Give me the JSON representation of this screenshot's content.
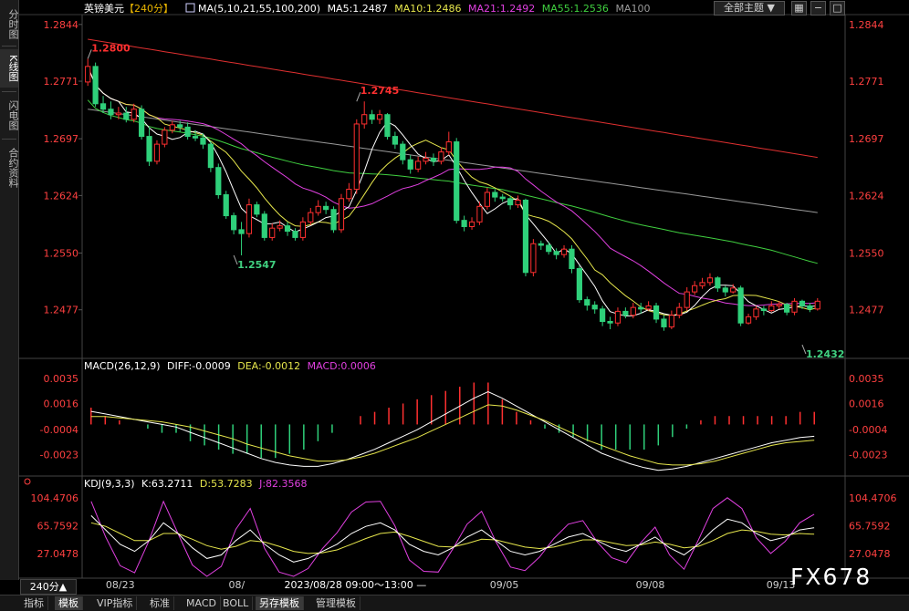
{
  "sidebar": {
    "tabs": [
      {
        "label": "分时图",
        "active": false
      },
      {
        "label": "K线图",
        "active": true
      },
      {
        "label": "闪电图",
        "active": false
      },
      {
        "label": "合约资料",
        "active": false
      }
    ]
  },
  "header": {
    "symbol": "英镑美元",
    "period": "【240分】",
    "ma_label": "MA(5,10,21,55,100,200)",
    "ma5": "MA5:1.2487",
    "ma10": "MA10:1.2486",
    "ma21": "MA21:1.2492",
    "ma55": "MA55:1.2536",
    "ma100": "MA100",
    "theme_button": "全部主题",
    "colors": {
      "symbol": "#ffffff",
      "period": "#e8b400",
      "ma5": "#ffffff",
      "ma10": "#e6e64c",
      "ma21": "#e040e0",
      "ma55": "#40d040",
      "ma100": "#9a9a9a",
      "ma200": "#e03030"
    }
  },
  "macd_header": {
    "label": "MACD(26,12,9)",
    "diff": "DIFF:-0.0009",
    "dea": "DEA:-0.0012",
    "macd": "MACD:0.0006"
  },
  "kdj_header": {
    "label": "KDJ(9,3,3)",
    "k": "K:63.2711",
    "d": "D:53.7283",
    "j": "J:82.3568"
  },
  "chart_data": {
    "type": "candlestick",
    "price_axis_ticks": [
      "1.2844",
      "1.2771",
      "1.2697",
      "1.2624",
      "1.2550",
      "1.2477"
    ],
    "price_range": [
      1.2418,
      1.2852
    ],
    "annotations": [
      {
        "text": "1.2800",
        "value": 1.28,
        "index": 0,
        "color": "#ff3030"
      },
      {
        "text": "1.2745",
        "value": 1.2745,
        "index": 35,
        "color": "#ff3030"
      },
      {
        "text": "1.2547",
        "value": 1.2547,
        "index": 19,
        "color": "#40d080"
      },
      {
        "text": "1.2432",
        "value": 1.2432,
        "index": 93,
        "color": "#40d080"
      }
    ],
    "x_labels": [
      {
        "text": "08/23",
        "index": 4
      },
      {
        "text": "08/",
        "index": 20
      },
      {
        "text": "09/05",
        "index": 54
      },
      {
        "text": "09/08",
        "index": 73
      },
      {
        "text": "09/13",
        "index": 90
      }
    ],
    "crosshair_label": "2023/08/28 09:00～13:00 —",
    "crosshair_index": 27,
    "close": [
      1.279,
      1.2742,
      1.2735,
      1.2728,
      1.273,
      1.2722,
      1.2735,
      1.27,
      1.2668,
      1.269,
      1.2708,
      1.2715,
      1.2712,
      1.27,
      1.2698,
      1.269,
      1.266,
      1.2625,
      1.2598,
      1.258,
      1.2575,
      1.2612,
      1.26,
      1.257,
      1.2582,
      1.2585,
      1.2578,
      1.257,
      1.259,
      1.2602,
      1.261,
      1.2606,
      1.258,
      1.262,
      1.2632,
      1.2716,
      1.2728,
      1.2722,
      1.2728,
      1.27,
      1.269,
      1.267,
      1.2658,
      1.2668,
      1.2672,
      1.2668,
      1.268,
      1.2693,
      1.2592,
      1.2584,
      1.259,
      1.261,
      1.2628,
      1.2622,
      1.262,
      1.2612,
      1.2618,
      1.2525,
      1.2562,
      1.256,
      1.2552,
      1.2548,
      1.2555,
      1.253,
      1.249,
      1.2483,
      1.2478,
      1.2462,
      1.246,
      1.2475,
      1.247,
      1.248,
      1.2478,
      1.2482,
      1.2465,
      1.2455,
      1.247,
      1.248,
      1.25,
      1.2508,
      1.2512,
      1.2518,
      1.2505,
      1.25,
      1.2505,
      1.246,
      1.2468,
      1.2478,
      1.2476,
      1.2482,
      1.2484,
      1.2474,
      1.2488,
      1.2482,
      1.2478,
      1.2488
    ],
    "open": [
      1.277,
      1.279,
      1.2742,
      1.2735,
      1.2728,
      1.273,
      1.2722,
      1.2735,
      1.27,
      1.2668,
      1.269,
      1.2708,
      1.2715,
      1.2712,
      1.27,
      1.2698,
      1.269,
      1.266,
      1.2625,
      1.2598,
      1.258,
      1.2575,
      1.2612,
      1.26,
      1.257,
      1.2582,
      1.2585,
      1.2578,
      1.257,
      1.259,
      1.2602,
      1.261,
      1.2606,
      1.258,
      1.262,
      1.2632,
      1.2716,
      1.2728,
      1.2722,
      1.2728,
      1.27,
      1.269,
      1.267,
      1.2658,
      1.2668,
      1.2672,
      1.2668,
      1.268,
      1.2693,
      1.2592,
      1.2584,
      1.259,
      1.261,
      1.2628,
      1.2622,
      1.262,
      1.2612,
      1.2618,
      1.2525,
      1.2562,
      1.256,
      1.2552,
      1.2548,
      1.2555,
      1.253,
      1.249,
      1.2483,
      1.2478,
      1.2462,
      1.246,
      1.2475,
      1.247,
      1.248,
      1.2478,
      1.2482,
      1.2465,
      1.2455,
      1.247,
      1.248,
      1.25,
      1.2508,
      1.2512,
      1.2518,
      1.2505,
      1.25,
      1.2505,
      1.246,
      1.2468,
      1.2478,
      1.2476,
      1.2482,
      1.2484,
      1.2474,
      1.2488,
      1.2482,
      1.2478
    ],
    "high": [
      1.28,
      1.2795,
      1.2752,
      1.2745,
      1.2738,
      1.2738,
      1.2742,
      1.274,
      1.2712,
      1.2695,
      1.2712,
      1.272,
      1.272,
      1.2718,
      1.2708,
      1.2704,
      1.2694,
      1.2665,
      1.263,
      1.2602,
      1.259,
      1.262,
      1.2616,
      1.2604,
      1.2588,
      1.2592,
      1.259,
      1.2582,
      1.2596,
      1.2608,
      1.2618,
      1.2616,
      1.261,
      1.2626,
      1.264,
      1.2722,
      1.2745,
      1.2734,
      1.2734,
      1.273,
      1.2706,
      1.2694,
      1.2676,
      1.2674,
      1.268,
      1.2678,
      1.2686,
      1.2706,
      1.2698,
      1.2598,
      1.2596,
      1.2616,
      1.2634,
      1.2632,
      1.2626,
      1.2624,
      1.2624,
      1.262,
      1.2568,
      1.2566,
      1.2564,
      1.2556,
      1.256,
      1.256,
      1.2534,
      1.2494,
      1.2488,
      1.2482,
      1.2468,
      1.248,
      1.248,
      1.2486,
      1.2486,
      1.2488,
      1.2486,
      1.247,
      1.2476,
      1.2486,
      1.2506,
      1.2514,
      1.2518,
      1.2524,
      1.252,
      1.2508,
      1.251,
      1.2508,
      1.2472,
      1.2482,
      1.2482,
      1.2488,
      1.2488,
      1.2486,
      1.2492,
      1.249,
      1.2486,
      1.2492
    ],
    "low": [
      1.2765,
      1.2738,
      1.273,
      1.2722,
      1.2722,
      1.2718,
      1.2718,
      1.2696,
      1.2662,
      1.2664,
      1.2686,
      1.2704,
      1.2706,
      1.2696,
      1.2694,
      1.2684,
      1.2654,
      1.262,
      1.2594,
      1.2574,
      1.2547,
      1.257,
      1.2596,
      1.2566,
      1.2566,
      1.2578,
      1.2572,
      1.2566,
      1.2566,
      1.2586,
      1.2598,
      1.26,
      1.2576,
      1.2576,
      1.2616,
      1.2626,
      1.271,
      1.2716,
      1.2716,
      1.2696,
      1.2684,
      1.2664,
      1.2652,
      1.2654,
      1.2664,
      1.2662,
      1.2664,
      1.2676,
      1.2588,
      1.2578,
      1.258,
      1.2586,
      1.2606,
      1.2616,
      1.2616,
      1.2606,
      1.2608,
      1.252,
      1.252,
      1.2554,
      1.2548,
      1.2542,
      1.2544,
      1.2524,
      1.2486,
      1.2476,
      1.2472,
      1.2456,
      1.2452,
      1.2456,
      1.2466,
      1.2466,
      1.2472,
      1.2476,
      1.246,
      1.245,
      1.2452,
      1.2466,
      1.2476,
      1.2496,
      1.2504,
      1.2508,
      1.25,
      1.2494,
      1.2498,
      1.2456,
      1.2458,
      1.2464,
      1.247,
      1.2474,
      1.2478,
      1.247,
      1.247,
      1.2478,
      1.2474,
      1.2476
    ],
    "macd": {
      "axis_ticks": [
        "0.0035",
        "0.0016",
        "-0.0004",
        "-0.0023"
      ],
      "range": [
        -0.0038,
        0.004
      ],
      "diff": [
        0.001,
        0.0008,
        0.0006,
        0.0004,
        0.0002,
        0.0,
        -0.0002,
        -0.0006,
        -0.001,
        -0.0014,
        -0.0018,
        -0.0022,
        -0.0026,
        -0.0029,
        -0.0031,
        -0.0032,
        -0.0032,
        -0.003,
        -0.0027,
        -0.0023,
        -0.0019,
        -0.0014,
        -0.0009,
        -0.0004,
        0.0002,
        0.0008,
        0.0014,
        0.002,
        0.0025,
        0.002,
        0.0014,
        0.0008,
        0.0002,
        -0.0004,
        -0.001,
        -0.0016,
        -0.0022,
        -0.0026,
        -0.003,
        -0.0033,
        -0.0035,
        -0.0034,
        -0.0032,
        -0.0029,
        -0.0026,
        -0.0023,
        -0.002,
        -0.0017,
        -0.0014,
        -0.0012,
        -0.001,
        -0.0009
      ],
      "dea": [
        0.0006,
        0.0006,
        0.0005,
        0.0004,
        0.0003,
        0.0002,
        0.0,
        -0.0002,
        -0.0005,
        -0.0008,
        -0.0011,
        -0.0015,
        -0.0018,
        -0.0021,
        -0.0024,
        -0.0026,
        -0.0028,
        -0.0028,
        -0.0027,
        -0.0025,
        -0.0022,
        -0.0018,
        -0.0014,
        -0.001,
        -0.0005,
        0.0,
        0.0005,
        0.001,
        0.0015,
        0.0014,
        0.0011,
        0.0007,
        0.0003,
        -0.0002,
        -0.0007,
        -0.0012,
        -0.0016,
        -0.002,
        -0.0024,
        -0.0027,
        -0.003,
        -0.0031,
        -0.0031,
        -0.003,
        -0.0028,
        -0.0025,
        -0.0022,
        -0.0019,
        -0.0016,
        -0.0014,
        -0.0013,
        -0.0012
      ]
    },
    "kdj": {
      "axis_ticks": [
        "104.4706",
        "65.7592",
        "27.0478"
      ],
      "range": [
        -5,
        115
      ],
      "k": [
        80,
        60,
        40,
        30,
        45,
        70,
        55,
        35,
        20,
        25,
        45,
        60,
        40,
        25,
        15,
        20,
        30,
        40,
        55,
        65,
        70,
        60,
        40,
        30,
        25,
        35,
        50,
        60,
        45,
        30,
        25,
        30,
        40,
        50,
        55,
        45,
        35,
        30,
        40,
        50,
        35,
        25,
        40,
        60,
        75,
        70,
        55,
        45,
        50,
        60,
        63
      ],
      "d": [
        70,
        65,
        55,
        45,
        45,
        55,
        55,
        47,
        38,
        33,
        37,
        45,
        43,
        37,
        30,
        27,
        28,
        32,
        40,
        48,
        55,
        57,
        51,
        44,
        37,
        36,
        41,
        47,
        46,
        41,
        36,
        34,
        36,
        41,
        46,
        46,
        42,
        38,
        39,
        43,
        40,
        35,
        37,
        45,
        55,
        60,
        58,
        54,
        53,
        55,
        54
      ],
      "j": [
        100,
        50,
        10,
        0,
        45,
        100,
        55,
        11,
        -5,
        9,
        61,
        90,
        34,
        1,
        -5,
        6,
        34,
        56,
        85,
        99,
        100,
        66,
        18,
        2,
        1,
        33,
        68,
        86,
        43,
        8,
        3,
        22,
        48,
        68,
        73,
        43,
        21,
        14,
        42,
        64,
        25,
        5,
        46,
        90,
        105,
        90,
        49,
        27,
        44,
        70,
        82
      ]
    },
    "ma": {
      "ma5": [
        1.2745,
        1.2738,
        1.2728,
        1.272,
        1.2712,
        1.2706,
        1.2702,
        1.2705,
        1.27,
        1.269,
        1.268,
        1.2658,
        1.2635,
        1.261,
        1.2596,
        1.2592,
        1.259,
        1.2588,
        1.2582,
        1.258,
        1.2585,
        1.259,
        1.2594,
        1.26,
        1.2612,
        1.2625,
        1.266,
        1.27,
        1.2725,
        1.2712,
        1.2694,
        1.2678,
        1.267,
        1.2672,
        1.2676,
        1.265,
        1.2628,
        1.261,
        1.2602,
        1.261,
        1.2618,
        1.262,
        1.26,
        1.2575,
        1.256,
        1.255,
        1.254,
        1.252,
        1.2498,
        1.248,
        1.247,
        1.2466,
        1.2468,
        1.2472,
        1.2476,
        1.2474,
        1.2472,
        1.2476,
        1.2485,
        1.2498,
        1.2508,
        1.2508,
        1.2495,
        1.2485,
        1.2476,
        1.2476,
        1.248,
        1.2482,
        1.2484,
        1.2487
      ],
      "ma10": [
        1.2748,
        1.2742,
        1.2736,
        1.2728,
        1.2722,
        1.2716,
        1.2712,
        1.2708,
        1.2702,
        1.2695,
        1.2682,
        1.2668,
        1.2652,
        1.2638,
        1.2622,
        1.2608,
        1.26,
        1.2594,
        1.259,
        1.259,
        1.2592,
        1.2596,
        1.2602,
        1.2614,
        1.263,
        1.2648,
        1.2668,
        1.2688,
        1.27,
        1.2697,
        1.269,
        1.268,
        1.2668,
        1.2652,
        1.264,
        1.263,
        1.2622,
        1.2618,
        1.2612,
        1.2606,
        1.2598,
        1.2586,
        1.2572,
        1.2558,
        1.2544,
        1.253,
        1.2516,
        1.2502,
        1.249,
        1.248,
        1.2475,
        1.2474,
        1.2474,
        1.2476,
        1.2478,
        1.2482,
        1.2488,
        1.2494,
        1.2498,
        1.25,
        1.25,
        1.2498,
        1.2494,
        1.249,
        1.2487,
        1.2486,
        1.2486,
        1.2486,
        1.2486,
        1.2486
      ]
    }
  },
  "bottom_tabs": [
    {
      "label": "指标",
      "active": false
    },
    {
      "label": "模板",
      "active": true
    },
    {
      "label": "VIP指标",
      "active": false
    },
    {
      "label": "标准",
      "active": false
    },
    {
      "label": "MACD",
      "active": false
    },
    {
      "label": "BOLL",
      "active": false
    },
    {
      "label": "另存模板",
      "active": true
    },
    {
      "label": "管理模板",
      "active": false
    }
  ],
  "period_selector": "240分▲",
  "watermark": "FX678"
}
